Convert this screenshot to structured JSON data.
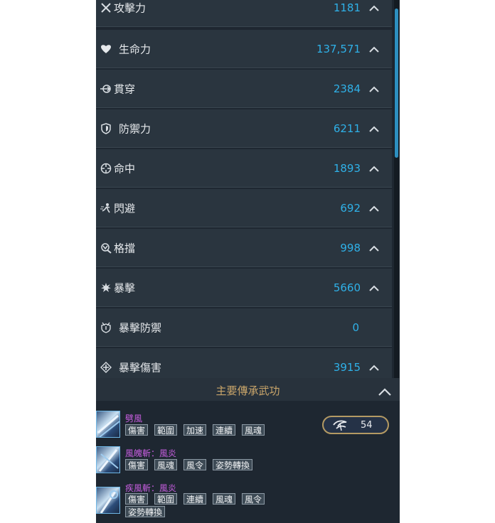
{
  "stats": [
    {
      "icon": "swords-icon",
      "label": "攻擊力",
      "value": "1181",
      "expand": true
    },
    {
      "icon": "heart-icon",
      "label": "生命力",
      "value": "137,571",
      "expand": true
    },
    {
      "icon": "pierce-icon",
      "label": "貫穿",
      "value": "2384",
      "expand": true
    },
    {
      "icon": "shield-icon",
      "label": "防禦力",
      "value": "6211",
      "expand": true
    },
    {
      "icon": "crosshair-icon",
      "label": "命中",
      "value": "1893",
      "expand": true
    },
    {
      "icon": "evade-icon",
      "label": "閃避",
      "value": "692",
      "expand": true
    },
    {
      "icon": "block-icon",
      "label": "格擋",
      "value": "998",
      "expand": true
    },
    {
      "icon": "critical-icon",
      "label": "暴擊",
      "value": "5660",
      "expand": true
    },
    {
      "icon": "crit-defense-icon",
      "label": "暴擊防禦",
      "value": "0",
      "expand": false
    },
    {
      "icon": "crit-damage-icon",
      "label": "暴擊傷害",
      "value": "3915",
      "expand": true
    }
  ],
  "legacy": {
    "title": "主要傳承武功",
    "badge_count": "54",
    "skills": [
      {
        "name": "劈風",
        "tags": [
          "傷害",
          "範圍",
          "加速",
          "連續",
          "風魂"
        ]
      },
      {
        "name": "風魄斬：風炎",
        "tags": [
          "傷害",
          "風魂",
          "風令",
          "姿勢轉換"
        ]
      },
      {
        "name": "疾風斬：風炎",
        "tags": [
          "傷害",
          "範圍",
          "連續",
          "風魂",
          "風令",
          "姿勢轉換"
        ]
      }
    ]
  },
  "colors": {
    "value": "#2fb1e8",
    "skill_name": "#c75ee0",
    "header_title": "#c9a56a",
    "badge_border": "#b49a63"
  }
}
